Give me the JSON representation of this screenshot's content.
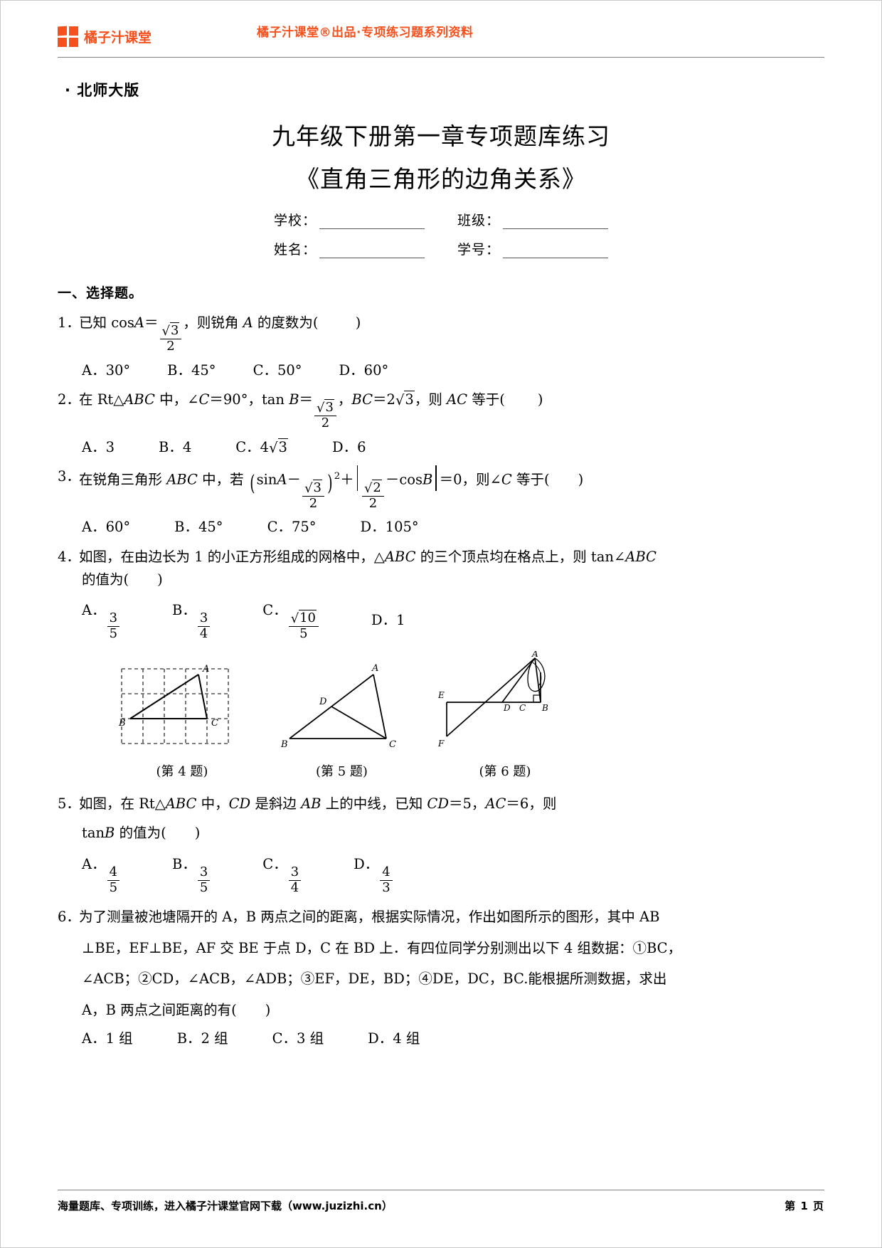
{
  "header": {
    "logo_text": "橘子汁课堂",
    "logo_icon": "four-squares-logo",
    "banner": "橘子汁课堂®出品·专项练习题系列资料",
    "brand_color": "#f4511e"
  },
  "title_block": {
    "edition": "· 北师大版",
    "title_line1": "九年级下册第一章专项题库练习",
    "title_line2": "《直角三角形的边角关系》",
    "fields": [
      {
        "label": "学校：",
        "value": ""
      },
      {
        "label": "班级：",
        "value": ""
      },
      {
        "label": "姓名：",
        "value": ""
      },
      {
        "label": "学号：",
        "value": ""
      }
    ]
  },
  "section": {
    "heading": "一、选择题。"
  },
  "questions": [
    {
      "num": "1．",
      "text_a": "已知",
      "cos": "cos",
      "var_a": "A",
      "eq": "＝",
      "frac_num": "3",
      "frac_den": "2",
      "text_b": "，则锐角",
      "var_a2": "A",
      "text_c": "的度数为(",
      "close": ")",
      "options": [
        "A．30°",
        "B．45°",
        "C．50°",
        "D．60°"
      ]
    },
    {
      "num": "2．",
      "t1": "在 Rt△",
      "abc": "ABC",
      "t2": "中，∠",
      "c1": "C",
      "t3": "＝90°，tan",
      "b1": "B",
      "eq": "＝",
      "frac_num": "3",
      "frac_den": "2",
      "t4": "，",
      "bc": "BC",
      "t5": "＝2",
      "sq": "3",
      "t6": "，则",
      "ac": "AC",
      "t7": "等于(",
      "close": ")",
      "options": [
        "A．3",
        "B．4",
        "C．4√3",
        "D．6"
      ],
      "opt_c_prefix": "C．4",
      "opt_c_sqrt": "3"
    },
    {
      "num": "3．",
      "t1": "在锐角三角形",
      "abc": "ABC",
      "t2": "中，若",
      "sin": "sin",
      "va": "A",
      "minus": "－",
      "f1n": "3",
      "f1d": "2",
      "pow": "2",
      "plus": "＋",
      "f2n": "2",
      "f2d": "2",
      "minus2": "－cos",
      "vb": "B",
      "eqzero": "＝0，则∠",
      "vc": "C",
      "t3": "等于(",
      "close": ")",
      "options": [
        "A．60°",
        "B．45°",
        "C．75°",
        "D．105°"
      ]
    },
    {
      "num": "4．",
      "line1": "如图，在由边长为 1 的小正方形组成的网格中，△ABC 的三个顶点均在格点上，则 tan∠ABC",
      "line1_pre": "如图，在由边长为 1 的小正方形组成的网格中，△",
      "line1_abc": "ABC",
      "line1_mid": " 的三个顶点均在格点上，则 tan∠",
      "line1_abc2": "ABC",
      "line2": "的值为(",
      "close": ")",
      "opt_a_label": "A．",
      "opt_a_num": "3",
      "opt_a_den": "5",
      "opt_b_label": "B．",
      "opt_b_num": "3",
      "opt_b_den": "4",
      "opt_c_label": "C．",
      "opt_c_num": "10",
      "opt_c_den": "5",
      "opt_d": "D．1"
    },
    {
      "num": "5．",
      "line1_pre": "如图，在 Rt△",
      "line1_abc": "ABC",
      "line1_m1": " 中，",
      "line1_cd": "CD",
      "line1_m2": " 是斜边 ",
      "line1_ab": "AB",
      "line1_m3": " 上的中线，已知 ",
      "line1_cd2": "CD",
      "line1_m4": "＝5，",
      "line1_ac": "AC",
      "line1_m5": "＝6，则",
      "line2_pre": "tan",
      "line2_b": "B",
      "line2_post": " 的值为(",
      "close": ")",
      "opt_a_label": "A．",
      "opt_a_num": "4",
      "opt_a_den": "5",
      "opt_b_label": "B．",
      "opt_b_num": "3",
      "opt_b_den": "5",
      "opt_c_label": "C．",
      "opt_c_num": "3",
      "opt_c_den": "4",
      "opt_d_label": "D．",
      "opt_d_num": "4",
      "opt_d_den": "3"
    },
    {
      "num": "6．",
      "line1": "为了测量被池塘隔开的 A，B 两点之间的距离，根据实际情况，作出如图所示的图形，其中 AB",
      "line2": "⊥BE，EF⊥BE，AF 交 BE 于点 D，C 在 BD 上．有四位同学分别测出以下 4 组数据：①BC，",
      "line3": "∠ACB；②CD，∠ACB，∠ADB；③EF，DE，BD；④DE，DC，BC.能根据所测数据，求出",
      "line4": "A，B 两点之间距离的有(",
      "close": ")",
      "options": [
        "A．1 组",
        "B．2 组",
        "C．3 组",
        "D．4 组"
      ]
    }
  ],
  "figures": [
    {
      "caption": "(第 4 题)",
      "labels": [
        "A",
        "B",
        "C"
      ]
    },
    {
      "caption": "(第 5 题)",
      "labels": [
        "A",
        "B",
        "C",
        "D"
      ]
    },
    {
      "caption": "(第 6 题)",
      "labels": [
        "A",
        "B",
        "C",
        "D",
        "E",
        "F"
      ]
    }
  ],
  "footer": {
    "note": "海量题库、专项训练，进入橘子汁课堂官网下载（www.juzizhi.cn）",
    "page": "第 1 页"
  }
}
